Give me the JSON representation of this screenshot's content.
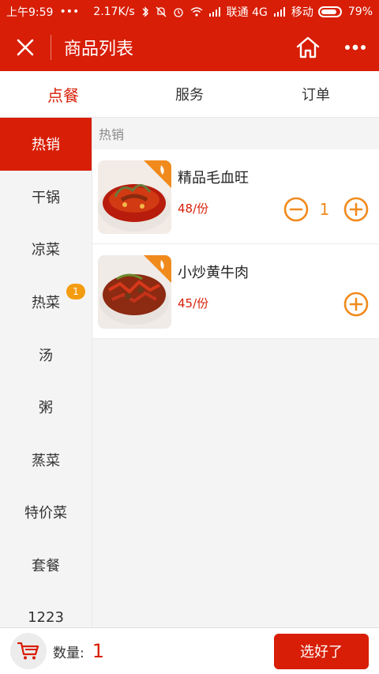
{
  "status_bar": {
    "time": "上午9:59",
    "dots": "•••",
    "network_speed": "2.17K/s",
    "carrier1": "联通 4G",
    "carrier2": "移动",
    "battery": "79%"
  },
  "nav": {
    "title": "商品列表"
  },
  "tabs": [
    {
      "label": "点餐"
    },
    {
      "label": "服务"
    },
    {
      "label": "订单"
    }
  ],
  "sidebar": {
    "items": [
      {
        "label": "热销"
      },
      {
        "label": "干锅"
      },
      {
        "label": "凉菜"
      },
      {
        "label": "热菜",
        "badge": "1"
      },
      {
        "label": "汤"
      },
      {
        "label": "粥"
      },
      {
        "label": "蒸菜"
      },
      {
        "label": "特价菜"
      },
      {
        "label": "套餐"
      },
      {
        "label": "1223"
      }
    ]
  },
  "content": {
    "section_label": "热销",
    "items": [
      {
        "name": "精品毛血旺",
        "price": "48/份",
        "quantity": "1"
      },
      {
        "name": "小炒黄牛肉",
        "price": "45/份"
      }
    ]
  },
  "bottom": {
    "qty_label": "数量:",
    "qty_total": "1",
    "confirm_label": "选好了"
  },
  "colors": {
    "brand": "#d81e06",
    "accent": "#f08a1d",
    "badge": "#f39c12"
  }
}
